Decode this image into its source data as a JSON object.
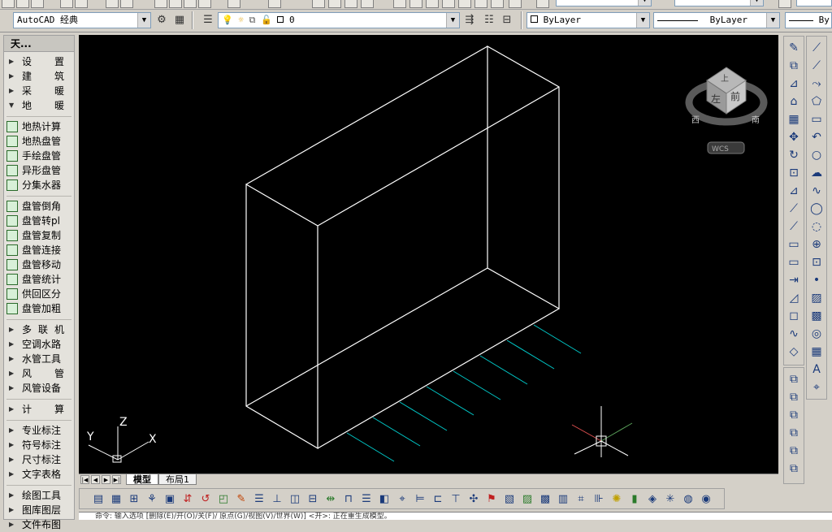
{
  "workspace": {
    "value": "AutoCAD 经典"
  },
  "layer": {
    "value": "0"
  },
  "color": {
    "value": "ByLayer"
  },
  "linetype": {
    "value": "ByLayer"
  },
  "lineweight": {
    "value": "By"
  },
  "left_panel": {
    "title": "天...",
    "categories_top": [
      {
        "label": [
          "设",
          "置"
        ],
        "state": "collapsed"
      },
      {
        "label": [
          "建",
          "筑"
        ],
        "state": "collapsed"
      },
      {
        "label": [
          "采",
          "暖"
        ],
        "state": "collapsed"
      },
      {
        "label": [
          "地",
          "暖"
        ],
        "state": "expanded"
      }
    ],
    "items_group1": [
      "地热计算",
      "地热盘管",
      "手绘盘管",
      "异形盘管",
      "分集水器"
    ],
    "items_group2": [
      "盘管倒角",
      "盘管转pl",
      "盘管复制",
      "盘管连接",
      "盘管移动",
      "盘管统计",
      "供回区分",
      "盘管加粗"
    ],
    "categories_mid": [
      {
        "label": [
          "多",
          "联",
          "机"
        ]
      },
      {
        "label": [
          "空调水路"
        ]
      },
      {
        "label": [
          "水管工具"
        ]
      },
      {
        "label": [
          "风",
          "管"
        ]
      },
      {
        "label": [
          "风管设备"
        ]
      }
    ],
    "categories_calc": [
      {
        "label": [
          "计",
          "算"
        ]
      }
    ],
    "categories_bottom": [
      "专业标注",
      "符号标注",
      "尺寸标注",
      "文字表格"
    ],
    "categories_tools": [
      "绘图工具",
      "图库图层",
      "文件布图"
    ]
  },
  "viewcube": {
    "top_label": "上",
    "left_label": "左",
    "front_label": "前",
    "west_label": "西",
    "south_label": "南",
    "wcs_label": "WCS"
  },
  "ucs": {
    "x": "X",
    "y": "Y",
    "z": "Z"
  },
  "tabs": [
    {
      "label": "模型",
      "active": true
    },
    {
      "label": "布局1",
      "active": false
    }
  ],
  "colors": {
    "canvas": "#000000",
    "edges": "#ffffff",
    "pipes": "#00c8c8",
    "toolbar": "#d4d0c8"
  },
  "commandline": {
    "text": "命令:    输入选项  [删除(E)/开(O)/关(F)/ 原点(G)/视图(V)/世界(W)] <开>:     正在重生成模型。"
  }
}
